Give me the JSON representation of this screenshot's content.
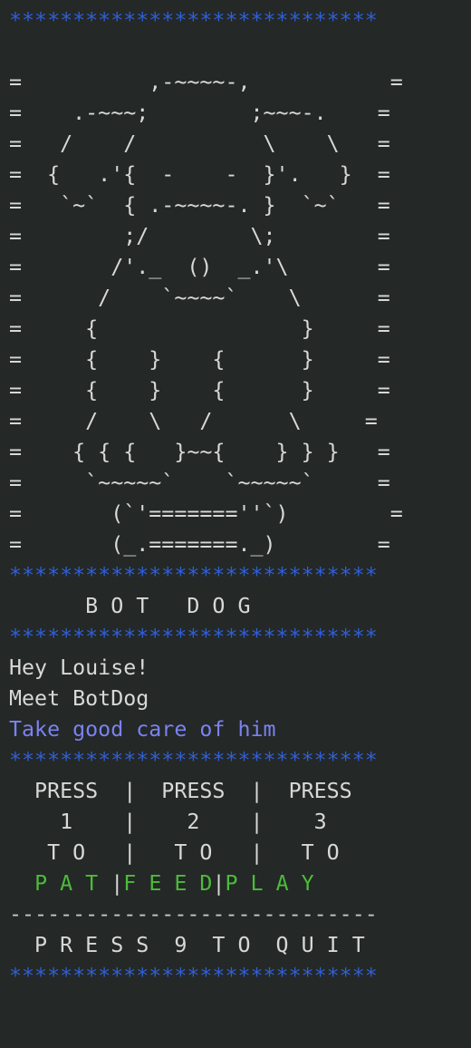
{
  "colors": {
    "background": "#242827",
    "text": "#d8d8d8",
    "border_stars": "#2f5fd8",
    "message_accent": "#7b82f2",
    "action_green": "#4dbb3a"
  },
  "border": "*****************************",
  "art": [
    "=          ,-~~~~-,           =",
    "=    .-~~~;        ;~~~-.    =",
    "=   /    /          \\    \\   =",
    "=  {   .'{  -    -  }'.   }  =",
    "=   `~`  { .-~~~~-. }  `~`   =",
    "=        ;/        \\;        =",
    "=       /'._  ()  _.'\\       =",
    "=      /    `~~~~`    \\      =",
    "=     {                }     =",
    "=     {    }    {      }     =",
    "=     {    }    {      }     =",
    "=     /    \\   /      \\     =",
    "=    { { {   }~~{    } } }   =",
    "=     `~~~~~`    `~~~~~`     =",
    "=       (`'=======''`)        =",
    "=       (_.=======._)        ="
  ],
  "title": "      B O T   D O G",
  "message": {
    "greeting": "Hey Louise!",
    "intro": "Meet BotDog",
    "care": "Take good care of him"
  },
  "menu": {
    "row1": "  PRESS  |  PRESS  |  PRESS",
    "row2": "    1    |    2    |    3",
    "row3": "   T O   |   T O   |   T O",
    "options": [
      {
        "key": "1",
        "pre": "  ",
        "action": "P A T",
        "sep": " |"
      },
      {
        "key": "2",
        "pre": "",
        "action": "F E E D",
        "sep": "|"
      },
      {
        "key": "3",
        "pre": "",
        "action": "P L A Y",
        "sep": ""
      }
    ]
  },
  "divider": "-----------------------------",
  "quit": "  P R E S S  9  T O  Q U I T"
}
